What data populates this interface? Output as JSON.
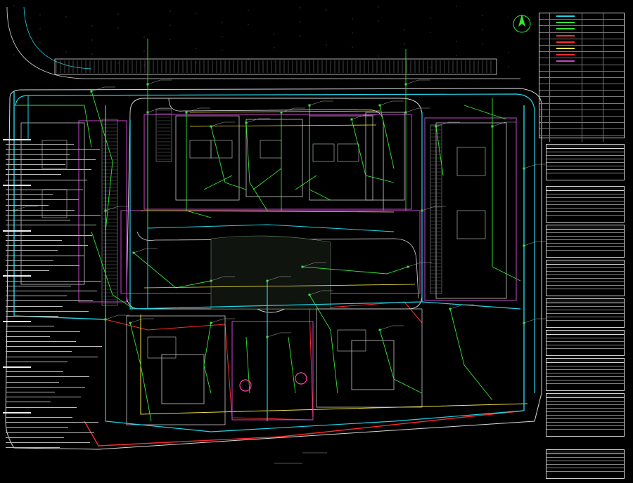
{
  "drawing": {
    "background": "#000000",
    "colors": {
      "boundary": "#ff2b2b",
      "road": "#d8d8d8",
      "water_main": "#22d3e6",
      "branch": "#33e633",
      "building": "#c9c9c9",
      "zone": "#cc44cc",
      "gas": "#f0e040",
      "detail": "#6b8e6b"
    },
    "icons": [
      "north-arrow-icon",
      "valve-icon",
      "hydrant-icon"
    ]
  },
  "legend_table": {
    "rows": 20,
    "swatches": [
      "#22d3e6",
      "#33e633",
      "#33e633",
      "#ff2b2b",
      "#ff2b2b",
      "#f0e040",
      "#ff2b2b",
      "#cc44cc"
    ]
  },
  "schedule_tables": {
    "count": 9,
    "rows_each": 9
  },
  "notes": {
    "line_count": 62
  }
}
